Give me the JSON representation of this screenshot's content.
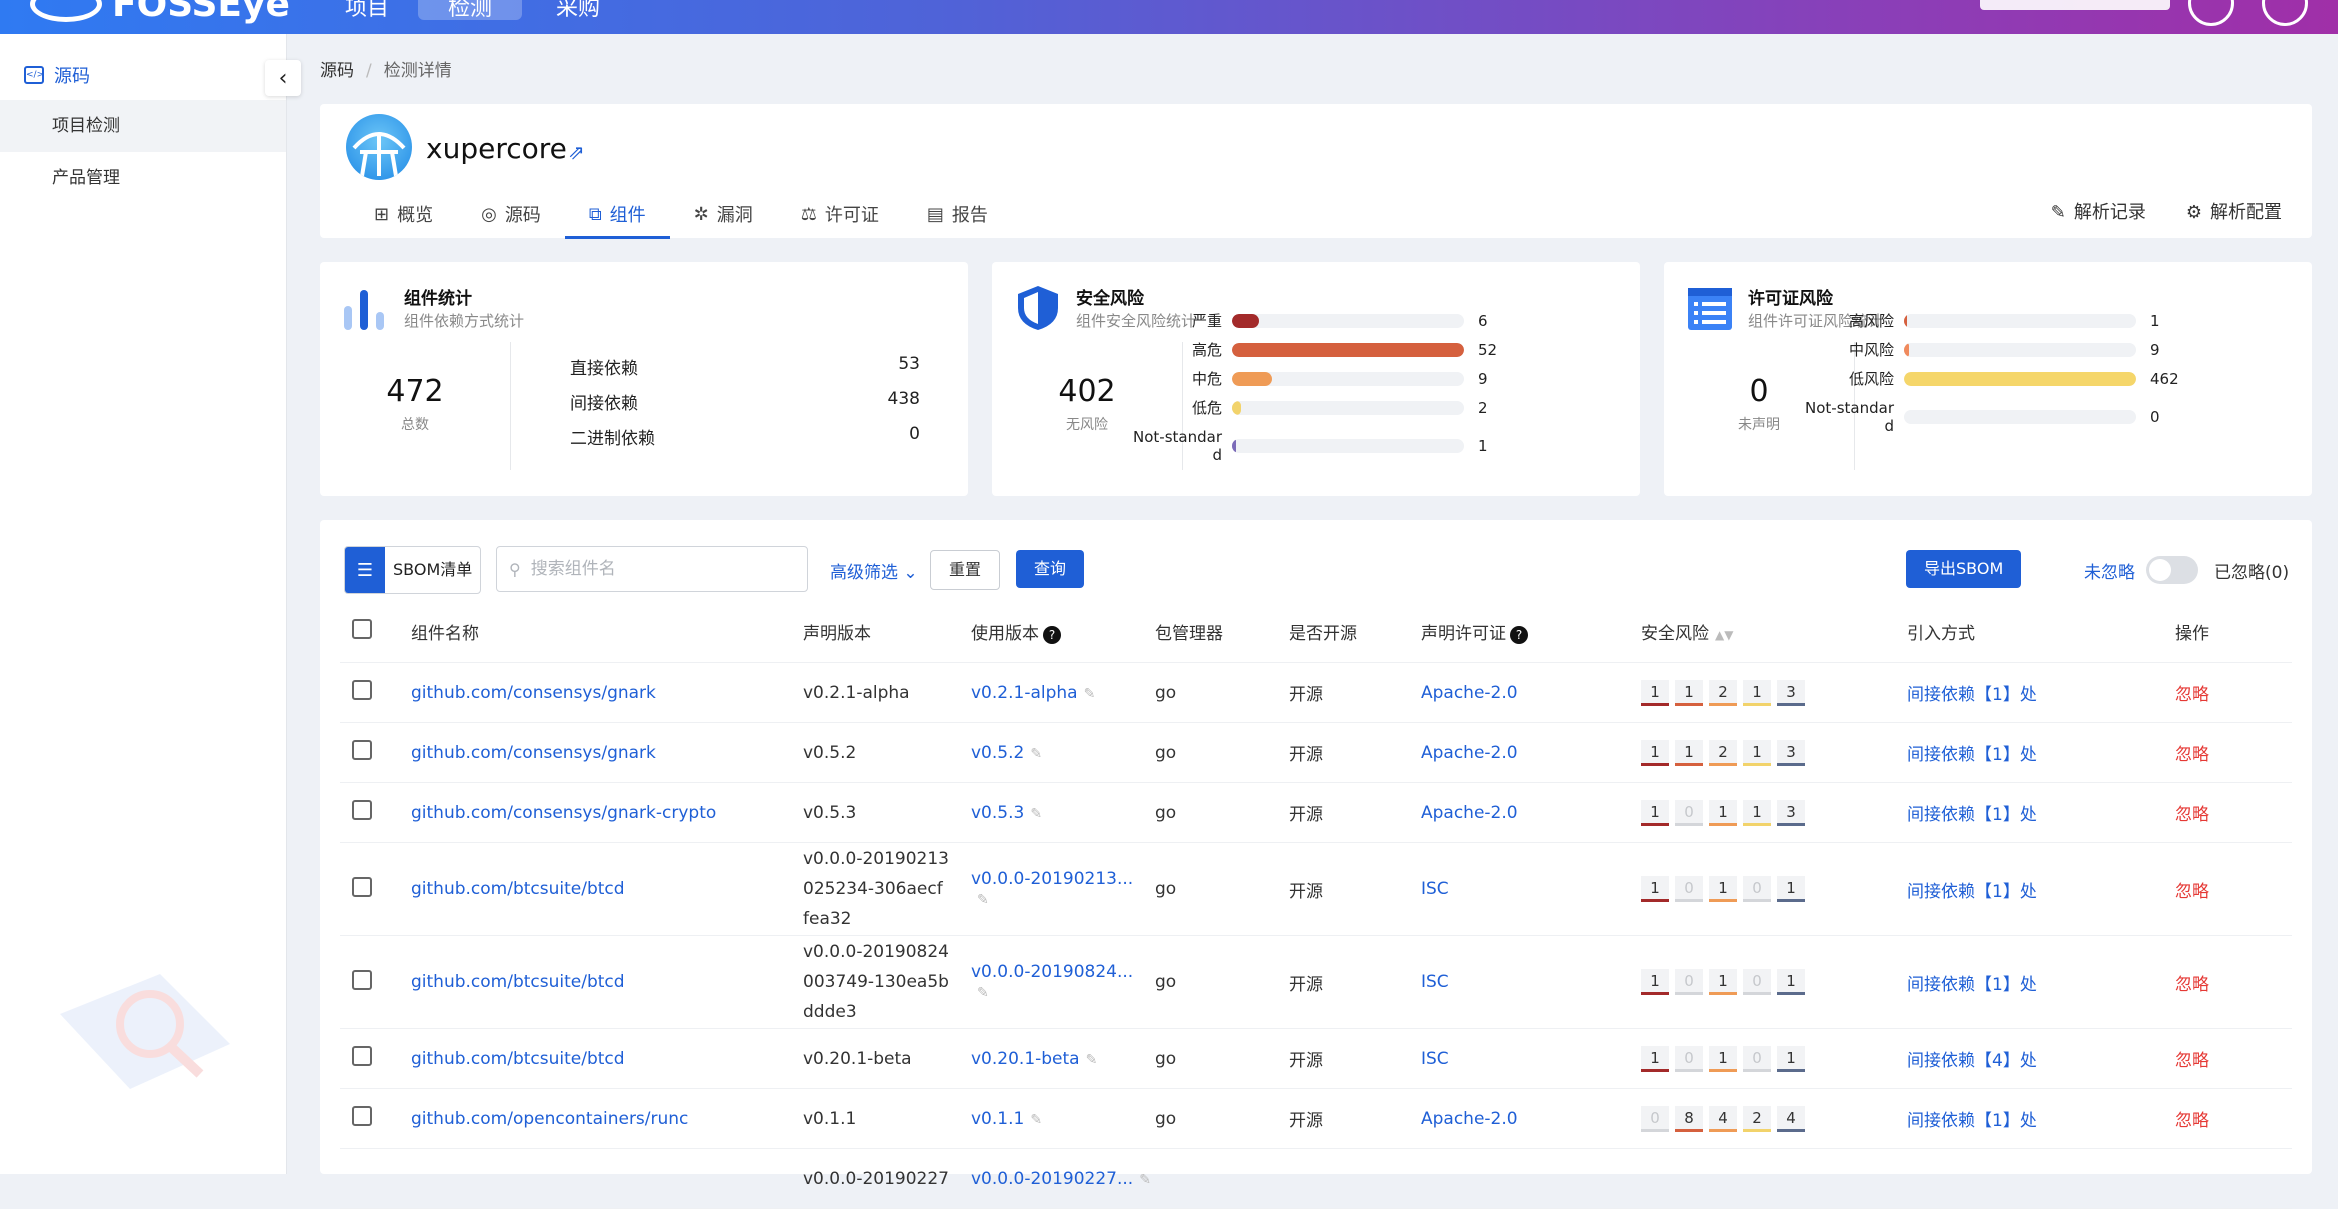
{
  "topbar": {
    "app_name": "FOSSEye",
    "nav": [
      "项目",
      "检测",
      "采购"
    ]
  },
  "sidebar": {
    "section": "源码",
    "items": [
      {
        "label": "项目检测",
        "active": true
      },
      {
        "label": "产品管理",
        "active": false
      }
    ]
  },
  "breadcrumb": {
    "root": "源码",
    "current": "检测详情"
  },
  "project": {
    "name": "xupercore",
    "tabs": [
      {
        "label": "概览",
        "icon": "overview-icon"
      },
      {
        "label": "源码",
        "icon": "source-icon"
      },
      {
        "label": "组件",
        "icon": "puzzle-icon",
        "active": true
      },
      {
        "label": "漏洞",
        "icon": "bug-icon"
      },
      {
        "label": "许可证",
        "icon": "scale-icon"
      },
      {
        "label": "报告",
        "icon": "report-icon"
      }
    ],
    "actions": [
      {
        "label": "解析记录",
        "icon": "log-icon"
      },
      {
        "label": "解析配置",
        "icon": "gear-icon"
      }
    ]
  },
  "stats": {
    "components": {
      "title": "组件统计",
      "subtitle": "组件依赖方式统计",
      "total": "472",
      "total_label": "总数",
      "rows": [
        {
          "label": "直接依赖",
          "value": "53"
        },
        {
          "label": "间接依赖",
          "value": "438"
        },
        {
          "label": "二进制依赖",
          "value": "0"
        }
      ]
    },
    "security": {
      "title": "安全风险",
      "subtitle": "组件安全风险统计",
      "total": "402",
      "total_label": "无风险",
      "bars": [
        {
          "label": "严重",
          "value": 6,
          "color": "#a32a2a"
        },
        {
          "label": "高危",
          "value": 52,
          "color": "#d5603e"
        },
        {
          "label": "中危",
          "value": 9,
          "color": "#ef9b56"
        },
        {
          "label": "低危",
          "value": 2,
          "color": "#f2d36b"
        },
        {
          "label": "Not-standard",
          "value": 1,
          "color": "#7b6bb8"
        }
      ],
      "max": 52
    },
    "license": {
      "title": "许可证风险",
      "subtitle": "组件许可证风险统计",
      "total": "0",
      "total_label": "未声明",
      "bars": [
        {
          "label": "高风险",
          "value": 1,
          "color": "#d5603e"
        },
        {
          "label": "中风险",
          "value": 9,
          "color": "#f08a5d"
        },
        {
          "label": "低风险",
          "value": 462,
          "color": "#f5d66a"
        },
        {
          "label": "Not-standard",
          "value": 0,
          "color": "#7b6bb8"
        }
      ],
      "max": 462
    }
  },
  "toolbar": {
    "sbom_label": "SBOM清单",
    "search_placeholder": "搜索组件名",
    "advanced": "高级筛选",
    "reset": "重置",
    "query": "查询",
    "export": "导出SBOM",
    "not_ignored": "未忽略",
    "ignored": "已忽略(0)"
  },
  "table": {
    "headers": [
      "组件名称",
      "声明版本",
      "使用版本",
      "包管理器",
      "是否开源",
      "声明许可证",
      "安全风险",
      "引入方式",
      "操作"
    ],
    "rows": [
      {
        "name": "github.com/consensys/gnark",
        "declared": [
          "v0.2.1-alpha"
        ],
        "used": "v0.2.1-alpha",
        "pm": "go",
        "open": "开源",
        "license": "Apache-2.0",
        "risk": [
          1,
          1,
          2,
          1,
          3
        ],
        "intro": "间接依赖【1】处",
        "op": "忽略"
      },
      {
        "name": "github.com/consensys/gnark",
        "declared": [
          "v0.5.2"
        ],
        "used": "v0.5.2",
        "pm": "go",
        "open": "开源",
        "license": "Apache-2.0",
        "risk": [
          1,
          1,
          2,
          1,
          3
        ],
        "intro": "间接依赖【1】处",
        "op": "忽略"
      },
      {
        "name": "github.com/consensys/gnark-crypto",
        "declared": [
          "v0.5.3"
        ],
        "used": "v0.5.3",
        "pm": "go",
        "open": "开源",
        "license": "Apache-2.0",
        "risk": [
          1,
          0,
          1,
          1,
          3
        ],
        "intro": "间接依赖【1】处",
        "op": "忽略"
      },
      {
        "name": "github.com/btcsuite/btcd",
        "declared": [
          "v0.0.0-20190213",
          "025234-306aecf",
          "fea32"
        ],
        "used": "v0.0.0-20190213...",
        "pm": "go",
        "open": "开源",
        "license": "ISC",
        "risk": [
          1,
          0,
          1,
          0,
          1
        ],
        "intro": "间接依赖【1】处",
        "op": "忽略"
      },
      {
        "name": "github.com/btcsuite/btcd",
        "declared": [
          "v0.0.0-20190824",
          "003749-130ea5b",
          "ddde3"
        ],
        "used": "v0.0.0-20190824...",
        "pm": "go",
        "open": "开源",
        "license": "ISC",
        "risk": [
          1,
          0,
          1,
          0,
          1
        ],
        "intro": "间接依赖【1】处",
        "op": "忽略"
      },
      {
        "name": "github.com/btcsuite/btcd",
        "declared": [
          "v0.20.1-beta"
        ],
        "used": "v0.20.1-beta",
        "pm": "go",
        "open": "开源",
        "license": "ISC",
        "risk": [
          1,
          0,
          1,
          0,
          1
        ],
        "intro": "间接依赖【4】处",
        "op": "忽略"
      },
      {
        "name": "github.com/opencontainers/runc",
        "declared": [
          "v0.1.1"
        ],
        "used": "v0.1.1",
        "pm": "go",
        "open": "开源",
        "license": "Apache-2.0",
        "risk": [
          0,
          8,
          4,
          2,
          4
        ],
        "intro": "间接依赖【1】处",
        "op": "忽略"
      },
      {
        "name": "",
        "declared": [
          "v0.0.0-20190227"
        ],
        "used": "v0.0.0-20190227...",
        "pm": "",
        "open": "",
        "license": "",
        "risk": [],
        "intro": "",
        "op": ""
      }
    ]
  }
}
